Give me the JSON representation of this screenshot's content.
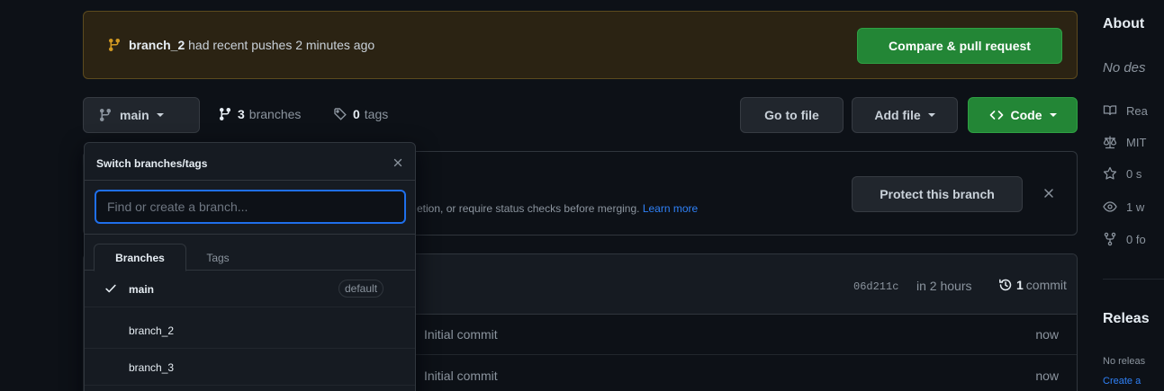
{
  "push_banner": {
    "branch": "branch_2",
    "message": "had recent pushes 2 minutes ago",
    "compare_label": "Compare & pull request"
  },
  "toolbar": {
    "current_branch": "main",
    "branch_count": "3",
    "branches_label": "branches",
    "tag_count": "0",
    "tags_label": "tags",
    "go_to_file": "Go to file",
    "add_file": "Add file",
    "code": "Code"
  },
  "protect": {
    "text": "etion, or require status checks before merging.",
    "learn_more": "Learn more",
    "button": "Protect this branch"
  },
  "commit": {
    "sha": "06d211c",
    "time": "in 2 hours",
    "count": "1",
    "count_label": "commit"
  },
  "files": [
    {
      "message": "Initial commit",
      "age": "now"
    },
    {
      "message": "Initial commit",
      "age": "now"
    }
  ],
  "dropdown": {
    "title": "Switch branches/tags",
    "placeholder": "Find or create a branch...",
    "tabs": [
      "Branches",
      "Tags"
    ],
    "items": [
      {
        "name": "main",
        "selected": true,
        "badge": "default"
      },
      {
        "name": "branch_2",
        "selected": false
      },
      {
        "name": "branch_3",
        "selected": false
      }
    ]
  },
  "sidebar": {
    "about_title": "About",
    "about_desc": "No des",
    "rows": [
      {
        "icon": "book-icon",
        "label": "Rea"
      },
      {
        "icon": "scale-icon",
        "label": "MIT"
      },
      {
        "icon": "star-icon",
        "label": "0 s"
      },
      {
        "icon": "eye-icon",
        "label": "1 w"
      },
      {
        "icon": "fork-icon",
        "label": "0 fo"
      }
    ],
    "releases_title": "Releas",
    "releases_none": "No releas",
    "releases_create": "Create a"
  },
  "colors": {
    "background": "#0d1117",
    "primary_green": "#238636",
    "link_blue": "#2f81f7",
    "banner_bg": "#2b2313",
    "banner_icon": "#d29922"
  }
}
